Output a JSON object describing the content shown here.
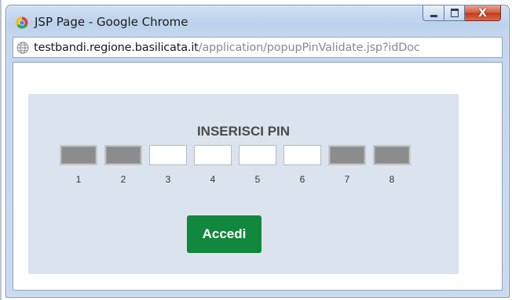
{
  "window": {
    "title": "JSP Page - Google Chrome",
    "controls": {
      "minimize": "–",
      "maximize": "□",
      "close": "X"
    }
  },
  "address_bar": {
    "host": "testbandi.regione.basilicata.it",
    "path": "/application/popupPinValidate.jsp?idDoc"
  },
  "pin_form": {
    "title": "INSERISCI PIN",
    "boxes": [
      {
        "number": "1",
        "state": "disabled"
      },
      {
        "number": "2",
        "state": "disabled"
      },
      {
        "number": "3",
        "state": "enabled"
      },
      {
        "number": "4",
        "state": "enabled"
      },
      {
        "number": "5",
        "state": "enabled"
      },
      {
        "number": "6",
        "state": "enabled"
      },
      {
        "number": "7",
        "state": "disabled"
      },
      {
        "number": "8",
        "state": "disabled"
      }
    ],
    "submit_label": "Accedi"
  },
  "colors": {
    "panel_bg": "#dbe4ee",
    "button_bg": "#11883d",
    "disabled_box": "#8c8c8c"
  },
  "icons": {
    "browser": "chrome-icon",
    "address": "globe-icon"
  }
}
